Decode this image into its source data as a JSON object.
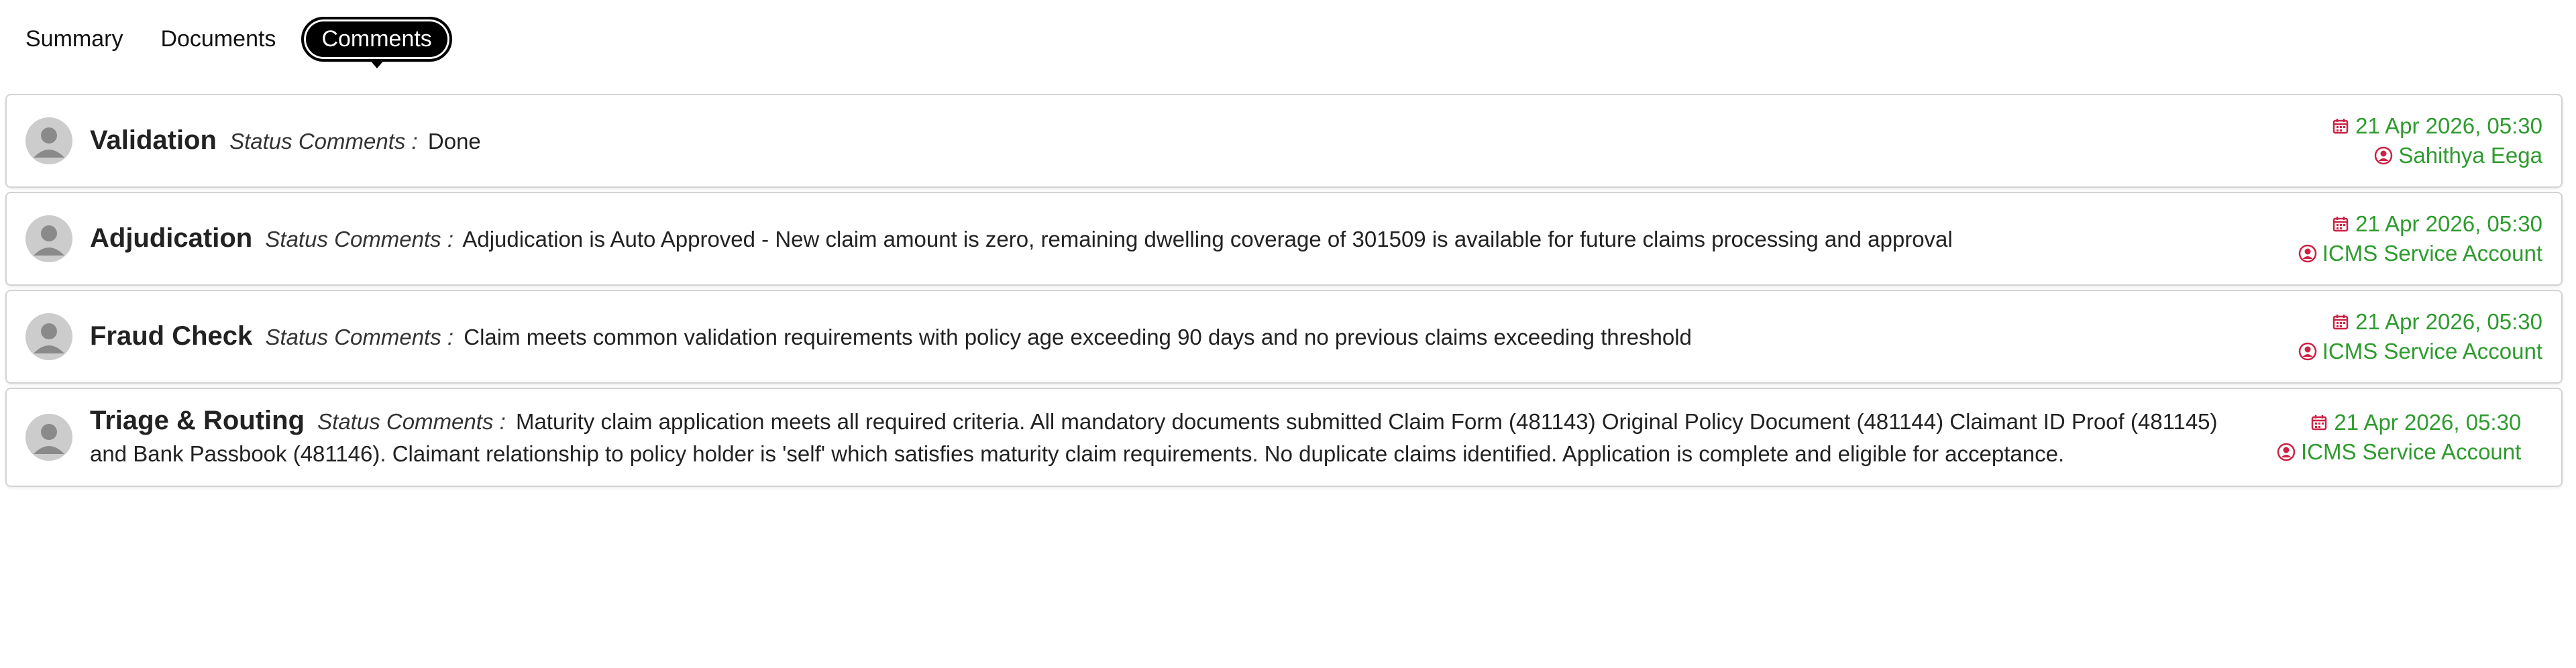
{
  "tabs": [
    {
      "label": "Summary",
      "active": false
    },
    {
      "label": "Documents",
      "active": false
    },
    {
      "label": "Comments",
      "active": true
    }
  ],
  "comments_label": "Status Comments :",
  "colors": {
    "meta_green": "#2e9b2e",
    "icon_red": "#cc2244",
    "tab_active_bg": "#000000"
  },
  "comments": [
    {
      "title": "Validation",
      "text": "Done",
      "date": "21 Apr 2026, 05:30",
      "user": "Sahithya Eega"
    },
    {
      "title": "Adjudication",
      "text": "Adjudication is Auto Approved -  New claim amount is zero, remaining dwelling coverage of 301509 is available for future claims processing and approval",
      "date": "21 Apr 2026, 05:30",
      "user": "ICMS Service Account"
    },
    {
      "title": "Fraud Check",
      "text": " Claim meets common validation requirements with policy age exceeding 90 days and no previous claims exceeding threshold",
      "date": "21 Apr 2026, 05:30",
      "user": "ICMS Service Account"
    },
    {
      "title": "Triage & Routing",
      "text": " Maturity claim application meets all required criteria. All mandatory documents submitted  Claim Form (481143) Original Policy Document (481144) Claimant ID Proof (481145) and Bank Passbook (481146). Claimant relationship to policy holder is 'self' which satisfies maturity claim requirements. No duplicate claims identified. Application is complete and eligible for acceptance.",
      "date": "21 Apr 2026, 05:30",
      "user": "ICMS Service Account"
    }
  ]
}
